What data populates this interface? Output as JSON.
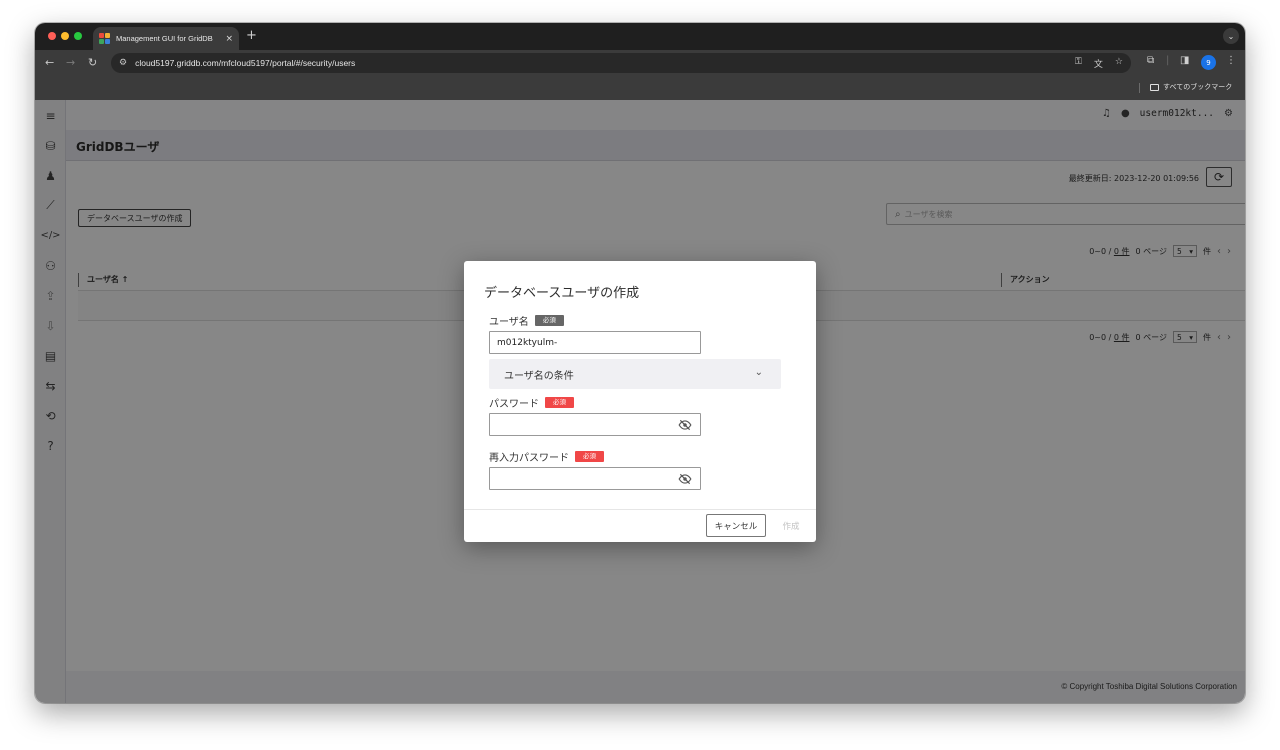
{
  "browser": {
    "tab_title": "Management GUI for GridDB",
    "tab_close": "×",
    "new_tab": "+",
    "tab_menu": "⌄",
    "url": "cloud5197.griddb.com/mfcloud5197/portal/#/security/users",
    "bookmark_all": "すべてのブックマーク",
    "profile_initial": "9"
  },
  "appbar": {
    "username": "userm012kt..."
  },
  "page": {
    "title": "GridDBユーザ",
    "last_updated": "最終更新日: 2023-12-20 01:09:56",
    "create_button": "データベースユーザの作成",
    "search_placeholder": "ユーザを検索",
    "pager": {
      "range": "0~0 /",
      "total": "0 件",
      "page": "0 ページ",
      "per_page": "5",
      "unit": "件"
    },
    "table": {
      "col_user": "ユーザ名 ↑",
      "col_action": "アクション"
    },
    "copyright": "© Copyright Toshiba Digital Solutions Corporation"
  },
  "dialog": {
    "title": "データベースユーザの作成",
    "username_label": "ユーザ名",
    "required_badge": "必須",
    "username_value": "m012ktyulm-",
    "conditions_label": "ユーザ名の条件",
    "password_label": "パスワード",
    "password_value": "",
    "confirm_label": "再入力パスワード",
    "confirm_value": "",
    "cancel_label": "キャンセル",
    "create_label": "作成"
  },
  "colors": {
    "required_red": "#f04747",
    "required_grey": "#666666",
    "profile_blue": "#1a73e8"
  }
}
